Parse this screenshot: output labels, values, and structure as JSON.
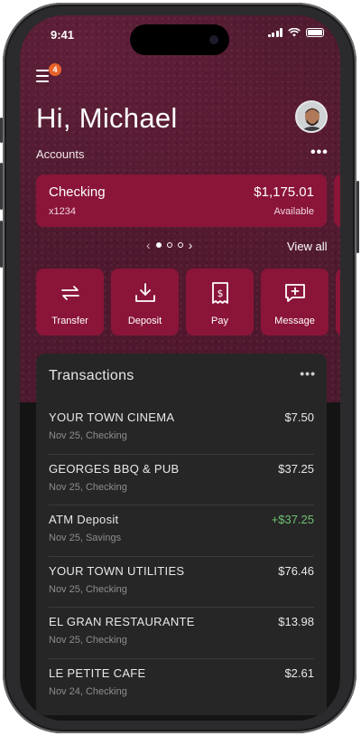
{
  "status_bar": {
    "time": "9:41"
  },
  "menu": {
    "badge_count": "4"
  },
  "greeting": "Hi, Michael",
  "accounts": {
    "label": "Accounts",
    "more": "•••",
    "card": {
      "name": "Checking",
      "number": "x1234",
      "balance": "$1,175.01",
      "balance_label": "Available"
    },
    "pager": {
      "prev": "‹",
      "next": "›",
      "pages": 3,
      "active_index": 0
    },
    "view_all": "View all"
  },
  "actions": [
    {
      "label": "Transfer",
      "icon": "transfer-icon"
    },
    {
      "label": "Deposit",
      "icon": "deposit-icon"
    },
    {
      "label": "Pay",
      "icon": "pay-icon"
    },
    {
      "label": "Message",
      "icon": "message-icon"
    }
  ],
  "transactions": {
    "title": "Transactions",
    "more": "•••",
    "items": [
      {
        "name": "YOUR TOWN CINEMA",
        "meta": "Nov 25, Checking",
        "amount": "$7.50",
        "credit": false
      },
      {
        "name": "GEORGES BBQ & PUB",
        "meta": "Nov 25, Checking",
        "amount": "$37.25",
        "credit": false
      },
      {
        "name": "ATM Deposit",
        "meta": "Nov 25, Savings",
        "amount": "+$37.25",
        "credit": true
      },
      {
        "name": "YOUR TOWN UTILITIES",
        "meta": "Nov 25, Checking",
        "amount": "$76.46",
        "credit": false
      },
      {
        "name": "EL GRAN RESTAURANTE",
        "meta": "Nov 25, Checking",
        "amount": "$13.98",
        "credit": false
      },
      {
        "name": "LE PETITE CAFE",
        "meta": "Nov 24, Checking",
        "amount": "$2.61",
        "credit": false
      }
    ]
  },
  "colors": {
    "brand": "#8a1538",
    "credit": "#6fbf73",
    "badge": "#e8622a"
  }
}
